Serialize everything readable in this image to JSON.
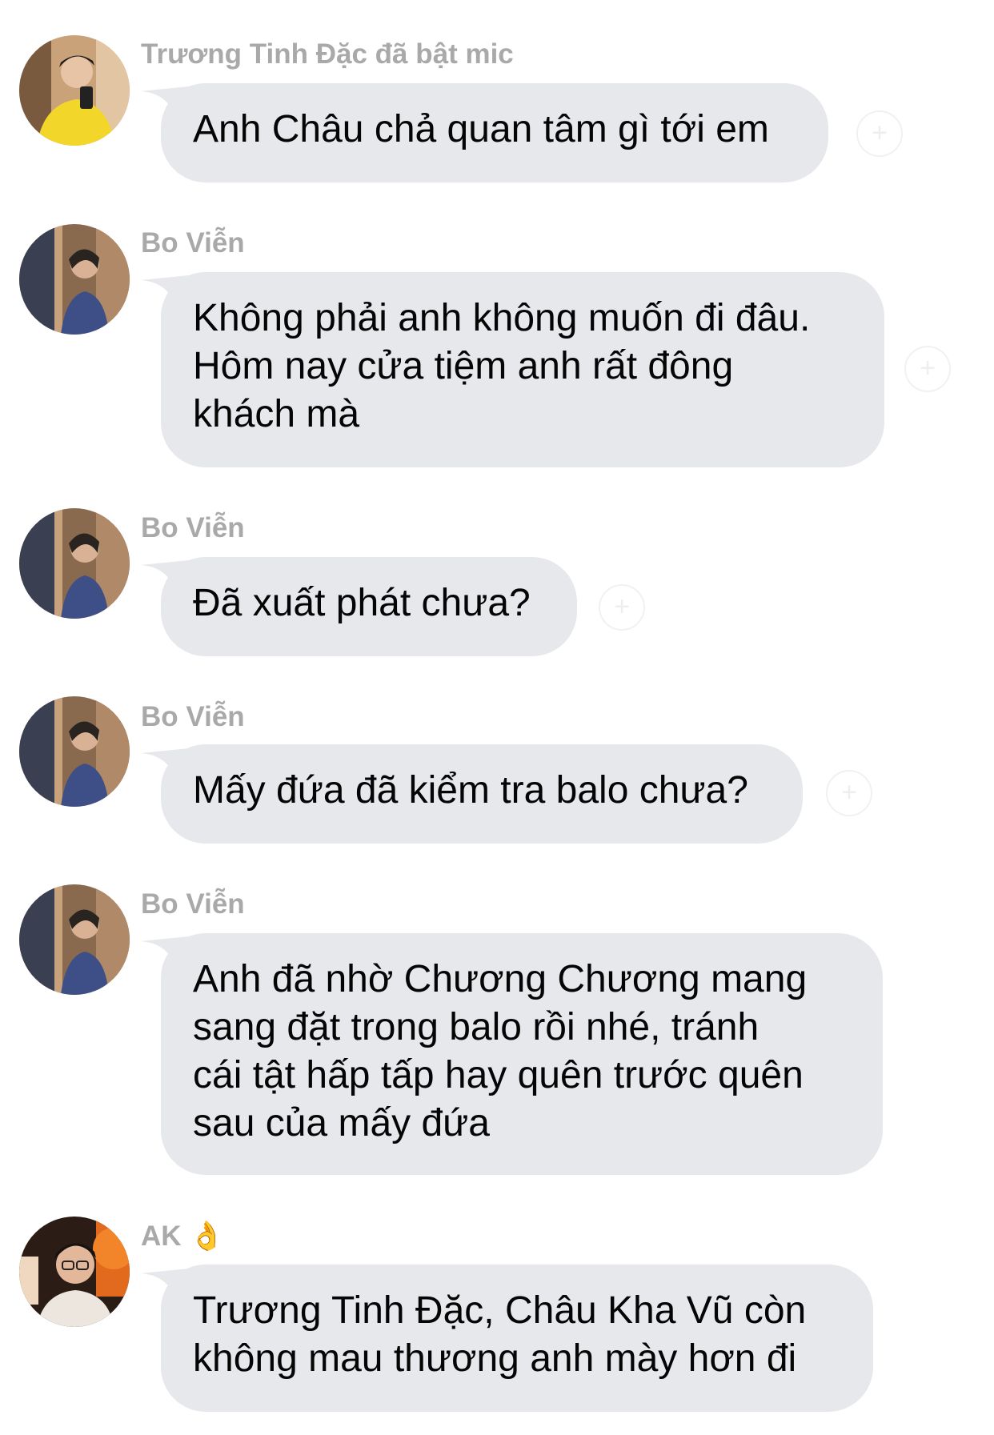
{
  "messages": [
    {
      "sender": "Trương Tinh Đặc đã bật mic",
      "lines": [
        "Anh Châu chả quan tâm gì tới em"
      ]
    },
    {
      "sender": "Bo Viễn",
      "lines": [
        "Không phải anh không muốn đi đâu.",
        "Hôm nay cửa tiệm anh rất đông",
        "khách mà"
      ]
    },
    {
      "sender": "Bo Viễn",
      "lines": [
        "Đã xuất phát chưa?"
      ]
    },
    {
      "sender": "Bo Viễn",
      "lines": [
        "Mấy đứa đã kiểm tra balo chưa?"
      ]
    },
    {
      "sender": "Bo Viễn",
      "lines": [
        "Anh đã nhờ Chương Chương mang",
        "sang đặt trong balo rồi nhé, tránh",
        "cái tật hấp tấp hay quên trước quên",
        "sau của mấy đứa"
      ]
    },
    {
      "sender": "AK",
      "sender_emoji": "👌",
      "lines": [
        "Trương Tinh Đặc, Châu Kha Vũ còn",
        "không mau thương anh mày hơn đi"
      ]
    }
  ],
  "react_icon": "plus-icon",
  "colors": {
    "bubble": "#e6e8ec",
    "sender_text": "#a9a9a9",
    "message_text": "#050505"
  }
}
